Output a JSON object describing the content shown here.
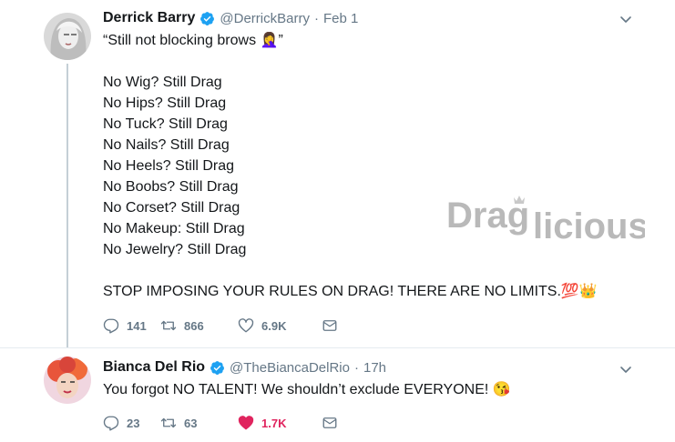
{
  "tweets": [
    {
      "name": "Derrick Barry",
      "handle": "@DerrickBarry",
      "separator": "·",
      "date": "Feb 1",
      "text_lines": [
        "“Still not blocking brows 🤦‍♀️”",
        "",
        "No Wig? Still Drag",
        "No Hips? Still Drag",
        "No Tuck? Still Drag",
        "No Nails? Still Drag",
        "No Heels? Still Drag",
        "No Boobs? Still Drag",
        "No Corset? Still Drag",
        "No Makeup: Still Drag",
        "No Jewelry? Still Drag",
        "",
        "STOP IMPOSING YOUR RULES ON DRAG! THERE ARE NO LIMITS.💯👑"
      ],
      "replies": "141",
      "retweets": "866",
      "likes": "6.9K",
      "liked": false
    },
    {
      "name": "Bianca Del Rio",
      "handle": "@TheBiancaDelRio",
      "separator": "·",
      "date": "17h",
      "text_lines": [
        "You forgot NO TALENT! We shouldn’t exclude EVERYONE! 😘"
      ],
      "replies": "23",
      "retweets": "63",
      "likes": "1.7K",
      "liked": true
    }
  ],
  "watermark": {
    "text_part1": "Drag",
    "text_part2": "licious"
  },
  "colors": {
    "text": "#14171a",
    "muted": "#657786",
    "verified": "#1da1f2",
    "like_active": "#e0245e",
    "thread": "#c4cfd6"
  },
  "icons": {
    "reply": "reply-icon",
    "retweet": "retweet-icon",
    "like": "heart-icon",
    "dm": "envelope-icon",
    "verified": "verified-badge-icon",
    "caret": "chevron-down-icon"
  }
}
